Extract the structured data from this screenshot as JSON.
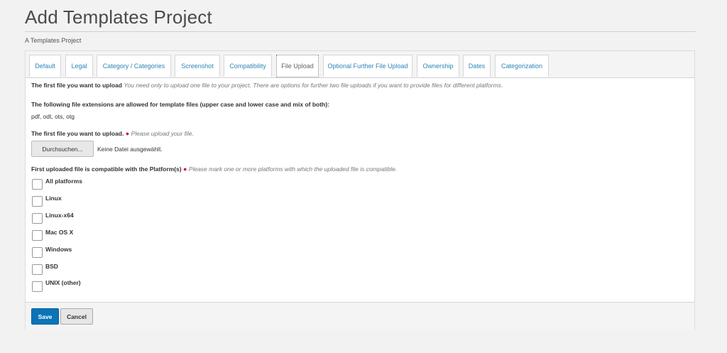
{
  "header": {
    "title": "Add Templates Project",
    "subtitle": "A Templates Project"
  },
  "tabs": [
    {
      "label": "Default"
    },
    {
      "label": "Legal"
    },
    {
      "label": "Category / Categories"
    },
    {
      "label": "Screenshot"
    },
    {
      "label": "Compatibility"
    },
    {
      "label": "File Upload"
    },
    {
      "label": "Optional Further File Upload"
    },
    {
      "label": "Ownership"
    },
    {
      "label": "Dates"
    },
    {
      "label": "Categorization"
    }
  ],
  "active_tab": "File Upload",
  "form": {
    "intro_bold": "The first file you want to upload",
    "intro_note": "You need only to upload one file to your project. There are options for further two file uploads if you want to provide files for different platforms.",
    "ext_heading": "The following file extensions are allowed for template files (upper case and lower case and mix of both):",
    "ext_list": "pdf, odt, ots, otg",
    "upload_label": "The first file you want to upload.",
    "required_marker": "●",
    "upload_hint": "Please upload your file.",
    "browse_label": "Durchsuchen...",
    "no_file_text": "Keine Datei ausgewählt.",
    "platform_label": "First uploaded file is compatible with the Platform(s)",
    "platform_hint": "Please mark one or more platforms with which the uploaded file is compatible.",
    "platforms": [
      {
        "label": "All platforms",
        "checked": false
      },
      {
        "label": "Linux",
        "checked": false
      },
      {
        "label": "Linux-x64",
        "checked": false
      },
      {
        "label": "Mac OS X",
        "checked": false
      },
      {
        "label": "Windows",
        "checked": false
      },
      {
        "label": "BSD",
        "checked": false
      },
      {
        "label": "UNIX (other)",
        "checked": false
      }
    ]
  },
  "actions": {
    "save_label": "Save",
    "cancel_label": "Cancel"
  },
  "colors": {
    "accent": "#0b74b7",
    "link": "#2d86b8",
    "required": "#c8202f"
  }
}
